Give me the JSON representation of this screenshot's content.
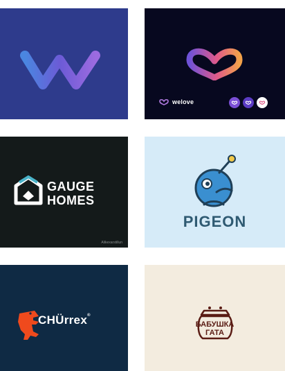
{
  "cards": [
    {
      "brand": "",
      "bg": "#2e3b8c"
    },
    {
      "brand": "welove",
      "bg": "#07081f"
    },
    {
      "brand_line1": "GAUGE",
      "brand_line2": "HOMES",
      "credit": "Alikexarstillun",
      "bg": "#141a1a"
    },
    {
      "brand": "PIGEON",
      "bg": "#d6ebf8"
    },
    {
      "brand": "CHÜrrex",
      "mark": "®",
      "bg": "#0f2a44"
    },
    {
      "brand_line1": "БАБУШКА",
      "brand_line2": "ГАТА",
      "bg": "#f3ecdf"
    }
  ],
  "colors": {
    "accent_purple": "#7b4fd6",
    "accent_pink": "#e05a8a",
    "accent_orange": "#f2a14a",
    "dino_orange": "#ef4a1d",
    "pigeon_blue": "#3a8fd0"
  }
}
